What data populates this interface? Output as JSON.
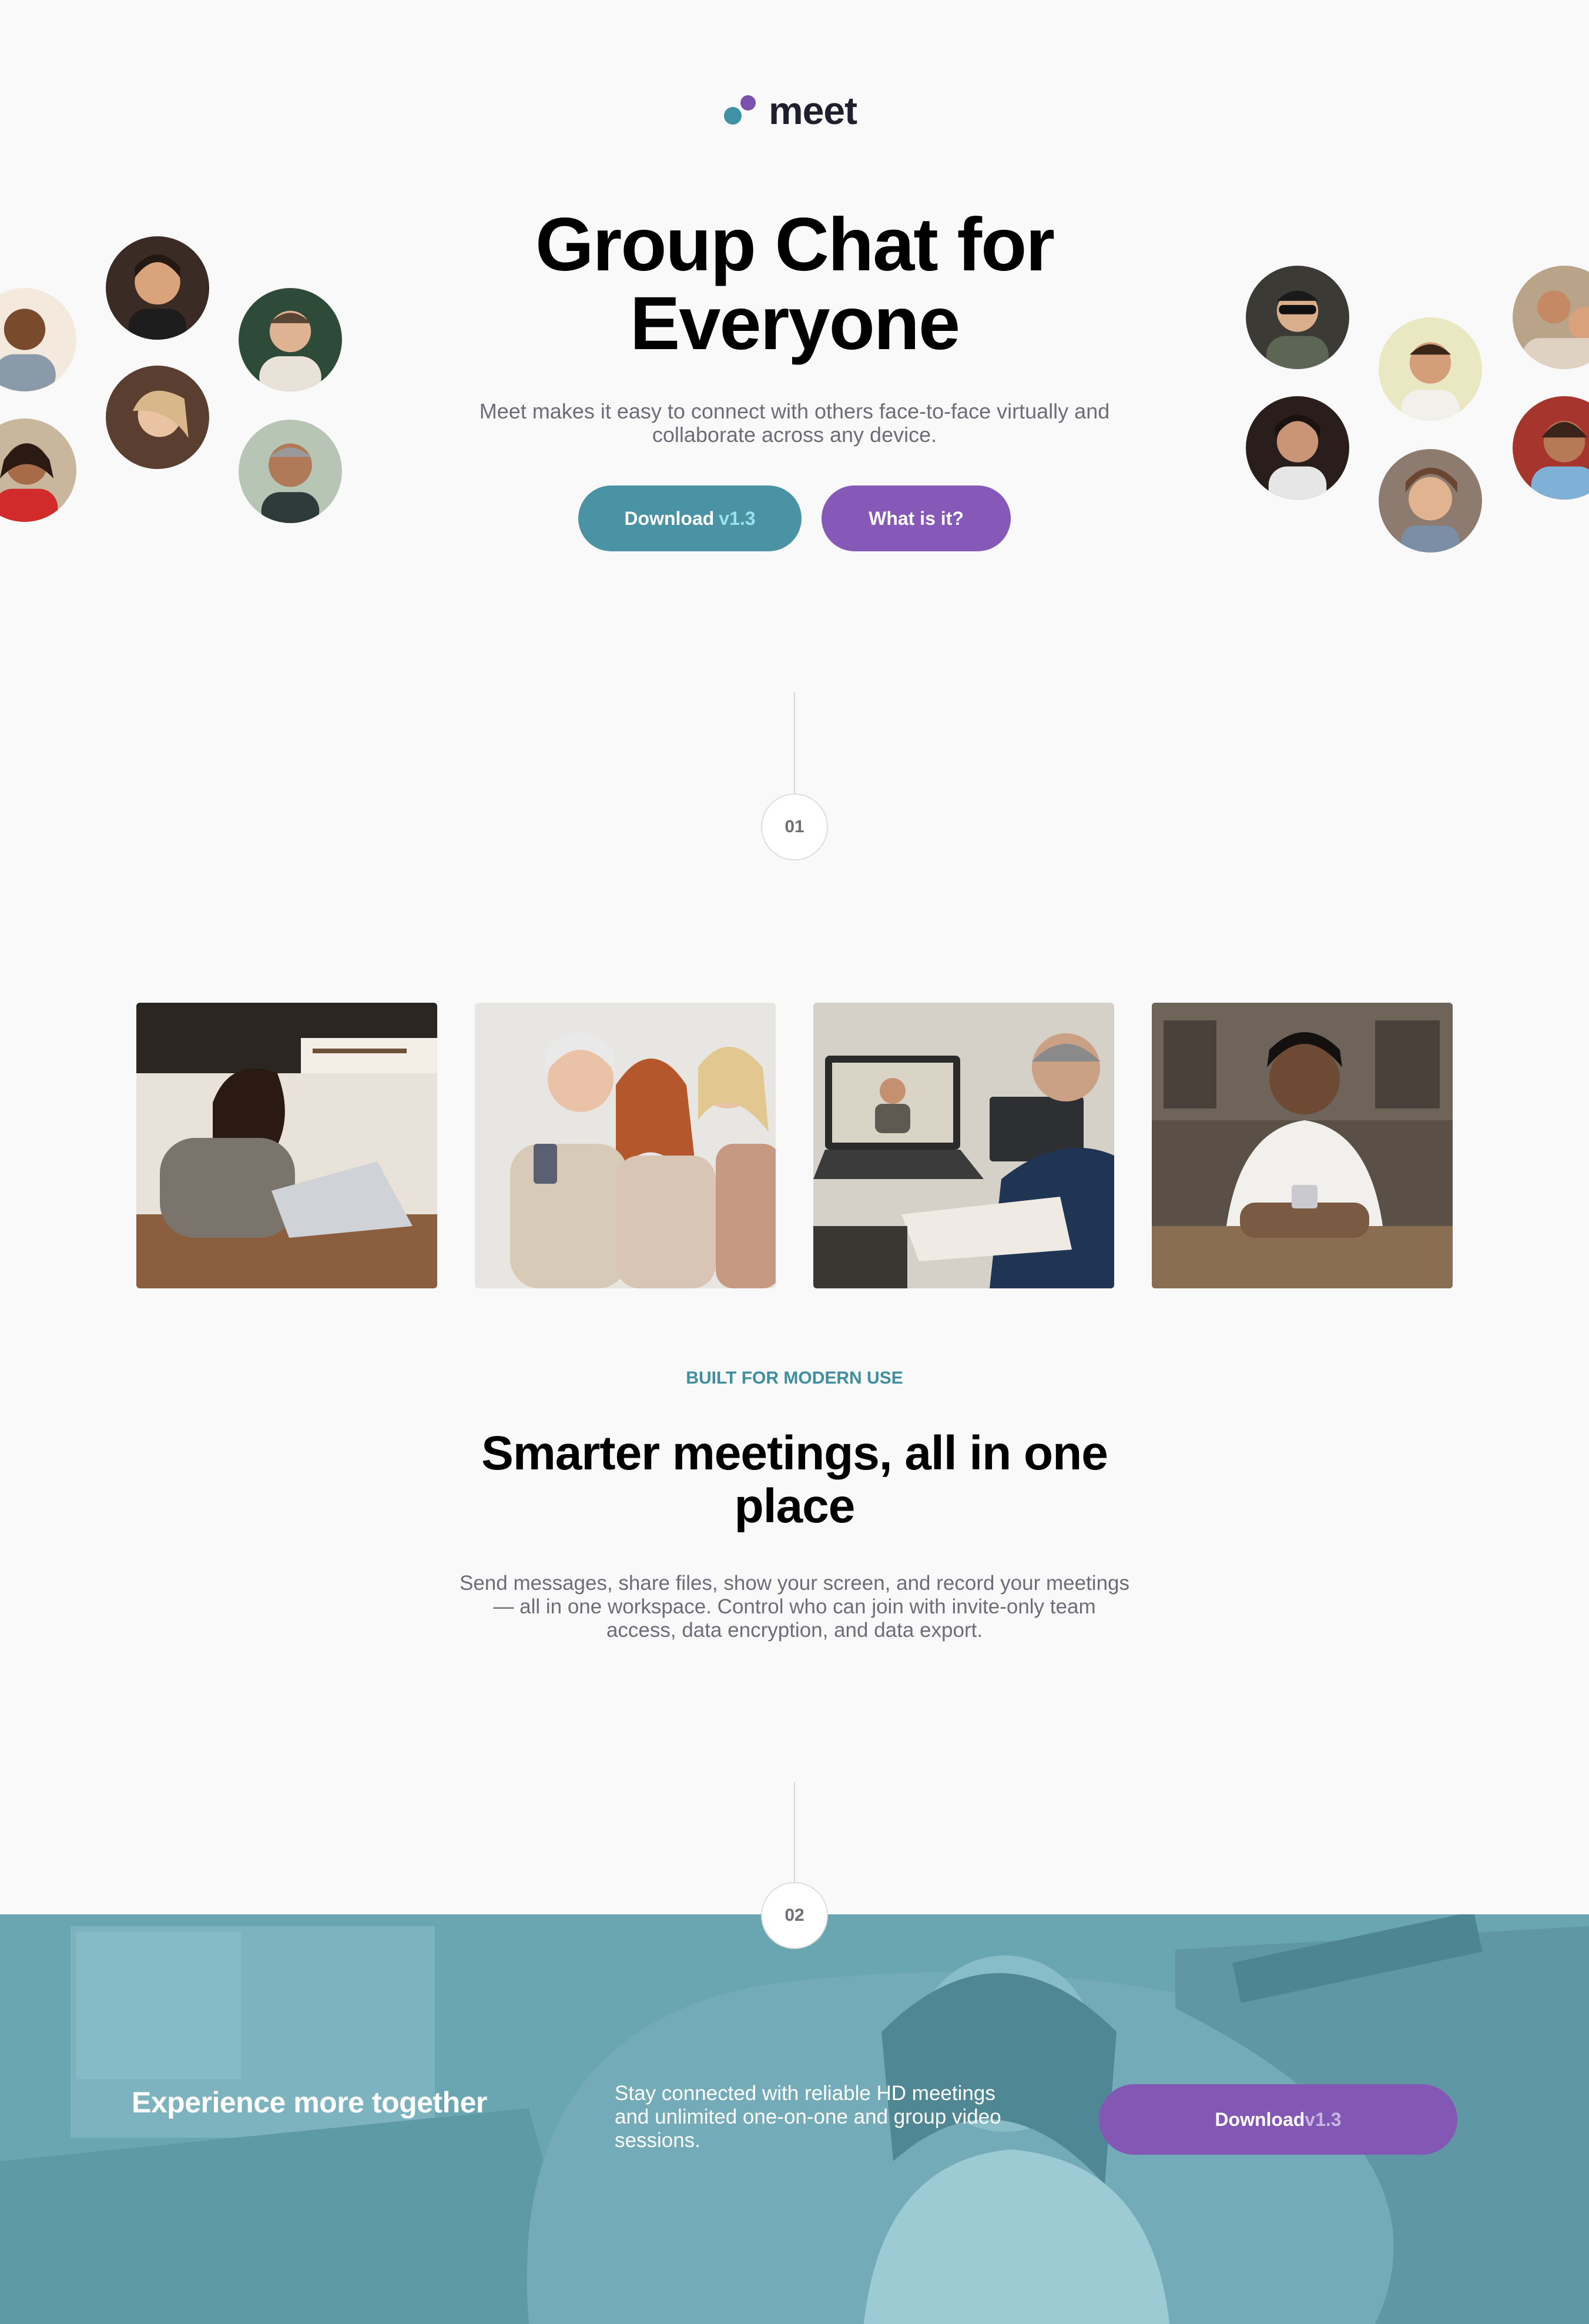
{
  "brand": {
    "name": "meet",
    "colors": {
      "teal": "#4a93a4",
      "purple": "#8658b8",
      "dark": "#1f1f2e"
    }
  },
  "hero": {
    "title_line1": "Group Chat for",
    "title_line2": "Everyone",
    "subtitle": "Meet makes it easy to connect with others face-to-face virtually and collaborate across any device.",
    "download_label": "Download",
    "download_version": "v1.3",
    "what_label": "What is it?"
  },
  "avatars_left": [
    "avatar-photo",
    "avatar-photo",
    "avatar-photo",
    "avatar-photo",
    "avatar-photo",
    "avatar-photo"
  ],
  "avatars_right": [
    "avatar-photo",
    "avatar-photo",
    "avatar-photo",
    "avatar-photo",
    "avatar-photo",
    "avatar-photo",
    "avatar-photo"
  ],
  "steps": [
    "01",
    "02"
  ],
  "photos": [
    "woman-laptop-photo",
    "women-phone-photo",
    "video-call-photo",
    "man-phone-photo"
  ],
  "features": {
    "eyebrow": "BUILT FOR MODERN USE",
    "title_line1": "Smarter meetings, all in one",
    "title_line2": "place",
    "body": "Send messages, share files, show your screen, and record your meetings — all in one workspace. Control who can join with invite-only team access, data encryption, and data export."
  },
  "cta": {
    "title": "Experience more together",
    "body": "Stay connected with reliable HD meetings and unlimited one-on-one and group video sessions.",
    "download_label": "Download",
    "download_version": "v1.3"
  }
}
